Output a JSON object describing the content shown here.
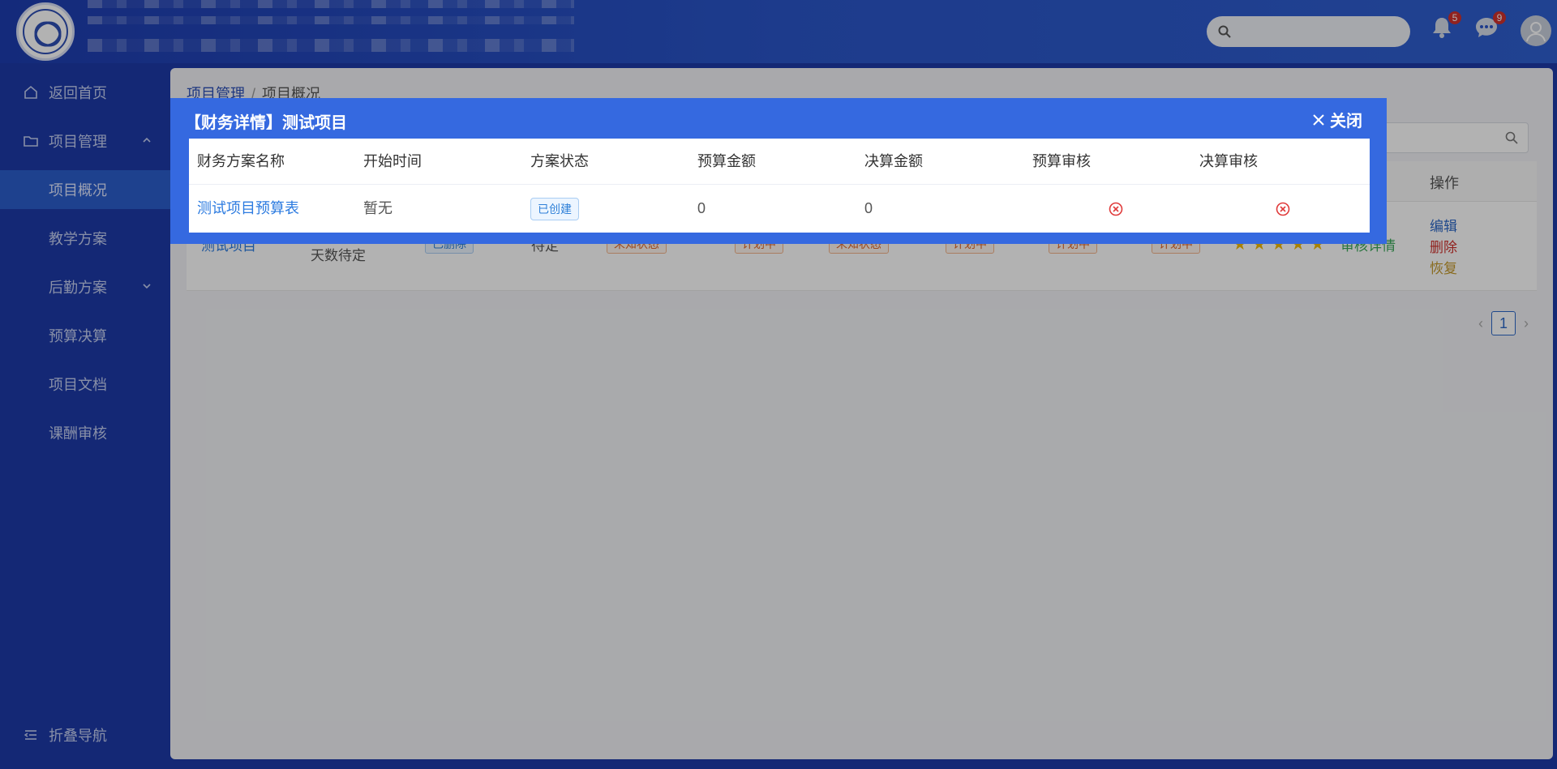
{
  "sidebar": {
    "items": [
      {
        "label": "返回首页",
        "icon": "home-icon"
      },
      {
        "label": "项目管理",
        "icon": "folder-icon"
      },
      {
        "label": "项目概况"
      },
      {
        "label": "教学方案"
      },
      {
        "label": "后勤方案"
      },
      {
        "label": "预算决算"
      },
      {
        "label": "项目文档"
      },
      {
        "label": "课酬审核"
      }
    ],
    "collapse_label": "折叠导航"
  },
  "header": {
    "notifications_count": "5",
    "messages_count": "9"
  },
  "breadcrumb": {
    "parent": "项目管理",
    "separator": "/",
    "current": "项目概况"
  },
  "table": {
    "op_header": "操作",
    "row": {
      "name": "测试项目",
      "days_line": "天数待定",
      "status_tag": "已删除",
      "pending": "待定",
      "tags": [
        "未知状态",
        "计划中",
        "未知状态",
        "计划中",
        "计划中",
        "计划中"
      ],
      "stars": "★★★★★",
      "review_link": "审核详情",
      "actions": [
        "编辑",
        "删除",
        "恢复"
      ]
    }
  },
  "pagination": {
    "current_page": "1"
  },
  "dialog": {
    "title": "【财务详情】测试项目",
    "close_label": "关闭",
    "columns": [
      "财务方案名称",
      "开始时间",
      "方案状态",
      "预算金额",
      "决算金额",
      "预算审核",
      "决算审核"
    ],
    "row": {
      "name": "测试项目预算表",
      "start_time": "暂无",
      "status": "已创建",
      "budget": "0",
      "final": "0"
    }
  },
  "colors": {
    "primary": "#3569e0",
    "sidebar_bg": "#1d3aa8",
    "active_nav": "#2b5dcc",
    "link": "#2c7be0",
    "warning_tag": "#e0682a",
    "error_icon": "#e03b3b"
  }
}
